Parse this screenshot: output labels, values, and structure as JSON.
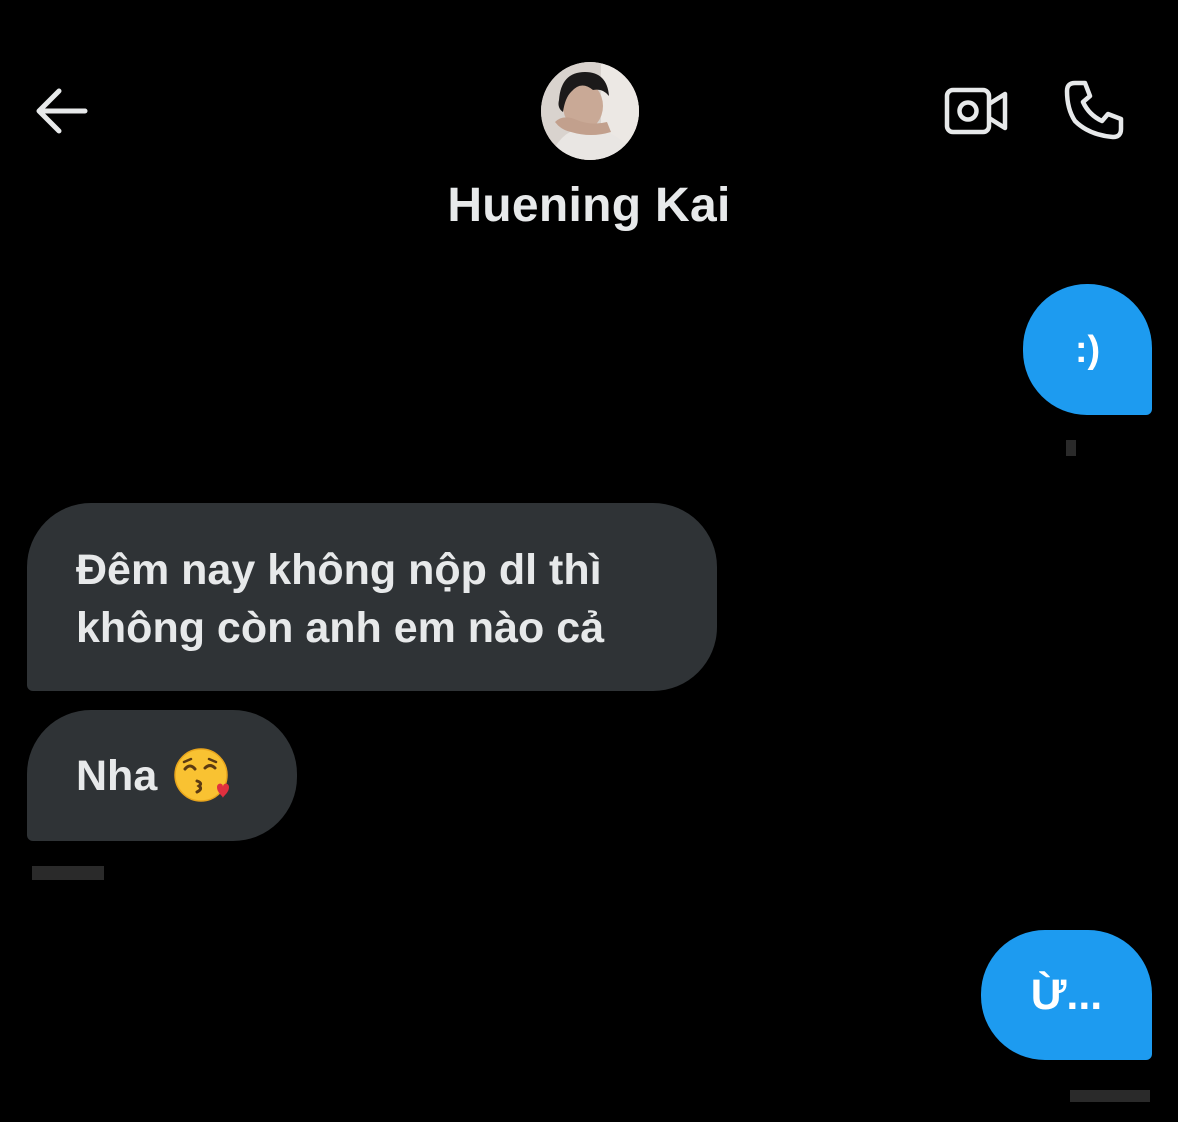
{
  "header": {
    "contact_name": "Huening Kai"
  },
  "icons": {
    "back": "arrow-left-icon",
    "video": "video-camera-icon",
    "call": "phone-icon",
    "emoji": "face-blowing-a-kiss-emoji"
  },
  "messages": [
    {
      "direction": "sent",
      "text": ":)"
    },
    {
      "direction": "received",
      "lines": [
        "Đêm nay không nộp dl thì",
        "không còn anh em nào cả"
      ]
    },
    {
      "direction": "received",
      "text": "Nha",
      "emoji": "😘"
    },
    {
      "direction": "sent",
      "text": "Ừ..."
    }
  ],
  "colors": {
    "background": "#000000",
    "sent_bubble": "#1d9bf0",
    "received_bubble": "#2f3336",
    "text_primary": "#e7e9ea"
  }
}
